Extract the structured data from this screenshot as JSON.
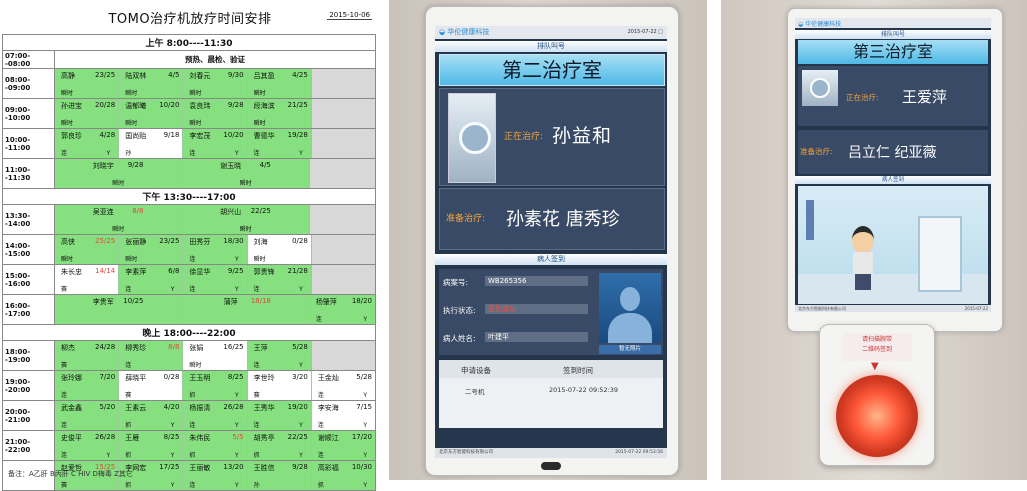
{
  "schedule": {
    "title": "TOMO治疗机放疗时间安排",
    "date": "2015-10-06",
    "note": "备注：A乙肝 B丙肝 C HIV D梅毒 Z其它",
    "colors": {
      "scheduled": "#86e07f",
      "open": "#ffffff",
      "empty": "#d8d8d8",
      "late": "#e04a3a"
    },
    "sessions": [
      {
        "label": "上午 8:00----11:30",
        "rows": [
          {
            "time": "07:00--08:00",
            "prep": "预热、晨检、验证"
          },
          {
            "time": "08:00--09:00",
            "cells": [
              {
                "name": "高静",
                "count": "23/25",
                "sub": "瞬时",
                "bg": "g"
              },
              {
                "name": "陆双林",
                "count": "4/5",
                "sub": "瞬时",
                "bg": "g"
              },
              {
                "name": "刘春元",
                "count": "9/30",
                "sub": "瞬时",
                "bg": "g"
              },
              {
                "name": "吕其盈",
                "count": "4/25",
                "sub": "瞬时",
                "bg": "g"
              },
              {
                "bg": "e"
              }
            ]
          },
          {
            "time": "09:00--10:00",
            "cells": [
              {
                "name": "孙进宝",
                "count": "20/28",
                "sub": "瞬时",
                "bg": "g"
              },
              {
                "name": "温郁曦",
                "count": "10/20",
                "sub": "瞬时",
                "bg": "g"
              },
              {
                "name": "袁良玮",
                "count": "9/28",
                "sub": "瞬时",
                "bg": "g"
              },
              {
                "name": "段海滨",
                "count": "21/25",
                "sub": "瞬时",
                "bg": "g"
              },
              {
                "bg": "e"
              }
            ]
          },
          {
            "time": "10:00--11:00",
            "cells": [
              {
                "name": "郭良珍",
                "count": "4/28",
                "sub": "连",
                "sub2": "Y",
                "bg": "g"
              },
              {
                "name": "国尚贻",
                "count": "9/18",
                "sub": "孙",
                "bg": "w"
              },
              {
                "name": "李宏茂",
                "count": "10/20",
                "sub": "连",
                "sub2": "Y",
                "bg": "g"
              },
              {
                "name": "曹德华",
                "count": "19/28",
                "sub": "连",
                "sub2": "Y",
                "bg": "g"
              },
              {
                "bg": "e"
              }
            ]
          },
          {
            "time": "11:00--11:30",
            "cells": [
              {
                "name": "刘晓宇",
                "count": "9/28",
                "sub": "瞬时",
                "bg": "g",
                "span": 2
              },
              {
                "name": "谢玉晓",
                "count": "4/5",
                "sub": "瞬时",
                "bg": "g",
                "span": 2
              },
              {
                "bg": "e"
              }
            ]
          }
        ]
      },
      {
        "label": "下午 13:30----17:00",
        "rows": [
          {
            "time": "13:30--14:00",
            "cells": [
              {
                "name": "吴亚连",
                "count": "8/8",
                "late": true,
                "sub": "瞬时",
                "bg": "g",
                "span": 2
              },
              {
                "name": "胡兴山",
                "count": "22/25",
                "sub": "瞬时",
                "bg": "g",
                "span": 2
              },
              {
                "bg": "e"
              }
            ]
          },
          {
            "time": "14:00--15:00",
            "cells": [
              {
                "name": "高侠",
                "count": "25/25",
                "late": true,
                "sub": "瞬时",
                "bg": "g"
              },
              {
                "name": "张丽静",
                "count": "23/25",
                "sub": "瞬时",
                "bg": "g"
              },
              {
                "name": "田秀芬",
                "count": "18/30",
                "sub": "连",
                "sub2": "Y",
                "bg": "g"
              },
              {
                "name": "刘海",
                "count": "0/28",
                "sub": "瞬时",
                "bg": "w"
              },
              {
                "bg": "e"
              }
            ]
          },
          {
            "time": "15:00--16:00",
            "cells": [
              {
                "name": "朱长忠",
                "count": "14/14",
                "late": true,
                "sub": "赛",
                "bg": "w"
              },
              {
                "name": "李素萍",
                "count": "6/8",
                "sub": "连",
                "sub2": "Y",
                "bg": "g"
              },
              {
                "name": "徐显华",
                "count": "9/25",
                "sub": "连",
                "sub2": "Y",
                "bg": "g"
              },
              {
                "name": "郭贵锋",
                "count": "21/28",
                "sub": "连",
                "sub2": "Y",
                "bg": "g"
              },
              {
                "bg": "e"
              }
            ]
          },
          {
            "time": "16:00--17:00",
            "cells": [
              {
                "name": "李贵军",
                "count": "10/25",
                "bg": "g",
                "span": 2
              },
              {
                "name": "蒲萍",
                "count": "18/18",
                "late": true,
                "bg": "g",
                "span": 2
              },
              {
                "name": "杨肇萍",
                "count": "18/20",
                "sub": "连",
                "sub2": "Y",
                "bg": "g"
              }
            ]
          }
        ]
      },
      {
        "label": "晚上 18:00----22:00",
        "rows": [
          {
            "time": "18:00--19:00",
            "cells": [
              {
                "name": "柳杰",
                "count": "24/28",
                "sub": "赛",
                "bg": "g"
              },
              {
                "name": "柳秀珍",
                "count": "8/8",
                "late": true,
                "sub": "连",
                "bg": "g"
              },
              {
                "name": "张娟",
                "count": "16/25",
                "sub": "瞬时",
                "bg": "w"
              },
              {
                "name": "王萍",
                "count": "5/28",
                "sub": "连",
                "sub2": "Y",
                "bg": "g"
              },
              {
                "bg": "e"
              }
            ]
          },
          {
            "time": "19:00--20:00",
            "cells": [
              {
                "name": "张玲娜",
                "count": "7/20",
                "sub": "连",
                "bg": "g"
              },
              {
                "name": "薛晓平",
                "count": "0/28",
                "sub": "赛",
                "bg": "w"
              },
              {
                "name": "王玉明",
                "count": "8/25",
                "sub": "抓",
                "sub2": "Y",
                "bg": "g"
              },
              {
                "name": "李世玲",
                "count": "3/20",
                "sub": "赛",
                "bg": "w"
              },
              {
                "name": "王金灿",
                "count": "5/28",
                "sub": "连",
                "sub2": "Y",
                "bg": "w"
              }
            ]
          },
          {
            "time": "20:00--21:00",
            "cells": [
              {
                "name": "武金鑫",
                "count": "5/20",
                "sub": "连",
                "bg": "g"
              },
              {
                "name": "王素云",
                "count": "4/20",
                "sub": "抓",
                "sub2": "Y",
                "bg": "g"
              },
              {
                "name": "杨振清",
                "count": "26/28",
                "sub": "连",
                "sub2": "Y",
                "bg": "g"
              },
              {
                "name": "王秀华",
                "count": "19/20",
                "sub": "连",
                "sub2": "Y",
                "bg": "g"
              },
              {
                "name": "李安海",
                "count": "7/15",
                "sub": "连",
                "sub2": "Y",
                "bg": "w"
              }
            ]
          },
          {
            "time": "21:00--22:00",
            "cells": [
              {
                "name": "史俊平",
                "count": "26/28",
                "sub": "连",
                "sub2": "Y",
                "bg": "g"
              },
              {
                "name": "王雁",
                "count": "8/25",
                "sub": "抓",
                "sub2": "Y",
                "bg": "g"
              },
              {
                "name": "朱伟民",
                "count": "5/5",
                "late": true,
                "sub": "抓",
                "sub2": "Y",
                "bg": "g"
              },
              {
                "name": "胡秀亭",
                "count": "22/25",
                "sub": "抓",
                "sub2": "Y",
                "bg": "g"
              },
              {
                "name": "谢顺江",
                "count": "17/20",
                "sub": "连",
                "sub2": "Y",
                "bg": "g"
              }
            ]
          },
          {
            "time": "",
            "cells": [
              {
                "name": "赵爱哲",
                "count": "15/25",
                "late": true,
                "sub": "赛",
                "bg": "g"
              },
              {
                "name": "李网宏",
                "count": "17/25",
                "sub": "抓",
                "sub2": "Y",
                "bg": "g"
              },
              {
                "name": "王丽敏",
                "count": "13/20",
                "sub": "连",
                "sub2": "Y",
                "bg": "g"
              },
              {
                "name": "王胜信",
                "count": "9/28",
                "sub": "孙",
                "bg": "g"
              },
              {
                "name": "高彩福",
                "count": "10/30",
                "sub": "抓",
                "sub2": "Y",
                "bg": "g"
              }
            ]
          }
        ]
      }
    ]
  },
  "display_room2": {
    "logo": "◒ 华伦健康科技",
    "timestamp": "2015-07-22 □",
    "queue_header": "排队叫号",
    "room": "第二治疗室",
    "current_label": "正在治疗:",
    "current_patient": "孙益和",
    "next_label": "准备治疗:",
    "next_patients": "孙素花  唐秀珍",
    "checkin_header": "病人签到",
    "case_label": "病案号:",
    "case_value": "WB265356",
    "status_label": "执行状态:",
    "status_value": "签到成功",
    "name_label": "病人姓名:",
    "name_value": "叶建平",
    "no_photo": "暂无照片",
    "table_headers": [
      "申请设备",
      "签到时间"
    ],
    "table_row": [
      "二号机",
      "2015-07-22  09:52:39"
    ],
    "footer_left": "北京东方智能科技有限公司",
    "footer_right": "2015-07-22 09:53:56"
  },
  "display_room3": {
    "logo": "◒ 华伦健康科技",
    "queue_header": "排队叫号",
    "room": "第三治疗室",
    "current_label": "正在治疗:",
    "current_patient": "王爱萍",
    "next_label": "准备治疗:",
    "next_patients": "吕立仁  纪亚薇",
    "scene_header": "病人签到",
    "footer_left": "北京东方智能科技有限公司",
    "footer_right": "2015-07-22",
    "scanner_label": "请扫描腕带\n二维码签到"
  }
}
